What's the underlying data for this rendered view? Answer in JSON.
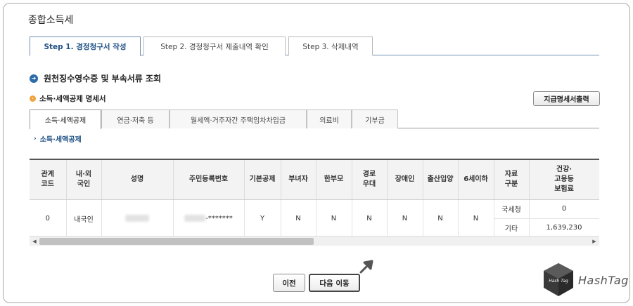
{
  "page_title": "종합소득세",
  "step_tabs": [
    {
      "label": "Step 1. 경정청구서 작성",
      "active": true
    },
    {
      "label": "Step 2. 경정청구서 제출내역 확인",
      "active": false
    },
    {
      "label": "Step 3. 삭제내역",
      "active": false
    }
  ],
  "section_title": "원천징수영수증 및 부속서류 조회",
  "sub_title": "소득·세액공제 명세서",
  "print_button": "지급명세서출력",
  "inner_tabs": [
    {
      "label": "소득·세액공제",
      "active": true
    },
    {
      "label": "연금·저축 등",
      "active": false
    },
    {
      "label": "월세액·거주자간 주택임차차입금",
      "active": false
    },
    {
      "label": "의료비",
      "active": false
    },
    {
      "label": "기부금",
      "active": false
    }
  ],
  "link_label": "소득·세액공제",
  "table": {
    "headers": [
      "관계\n코드",
      "내·외\n국인",
      "성명",
      "주민등록번호",
      "기본공제",
      "부녀자",
      "한부모",
      "경로\n우대",
      "장애인",
      "출산입양",
      "6세이하",
      "자료\n구분",
      "건강·\n고용등\n보험료"
    ],
    "row": {
      "relation_code": "0",
      "nationality": "내국인",
      "name": "",
      "rrn_suffix": "-*******",
      "basic_deduction": "Y",
      "woman": "N",
      "single_parent": "N",
      "elderly": "N",
      "disabled": "N",
      "birth_adoption": "N",
      "under6": "N",
      "sources": [
        {
          "type": "국세청",
          "amount": "0"
        },
        {
          "type": "기타",
          "amount": "1,639,230"
        }
      ]
    }
  },
  "buttons": {
    "prev": "이전",
    "next": "다음 이동"
  },
  "logo": {
    "cube_text": "Hash Tag",
    "word": "HashTag"
  },
  "colors": {
    "accent_blue": "#1d4f84",
    "tab_border": "#6e8fb2",
    "orange": "#f0a23c"
  }
}
